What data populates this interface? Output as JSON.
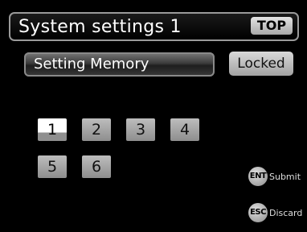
{
  "header": {
    "title": "System settings 1",
    "top_button_label": "TOP"
  },
  "setting": {
    "label": "Setting Memory",
    "status_button_label": "Locked"
  },
  "memory_slots": {
    "selected": "1",
    "labels": [
      "1",
      "2",
      "3",
      "4",
      "5",
      "6"
    ]
  },
  "key_hints": [
    {
      "key": "ENT",
      "action": "Submit"
    },
    {
      "key": "ESC",
      "action": "Discard"
    }
  ],
  "colors": {
    "background": "#000000",
    "button_gray": "#a8a8a8",
    "selected_slot": "#ffffff"
  }
}
